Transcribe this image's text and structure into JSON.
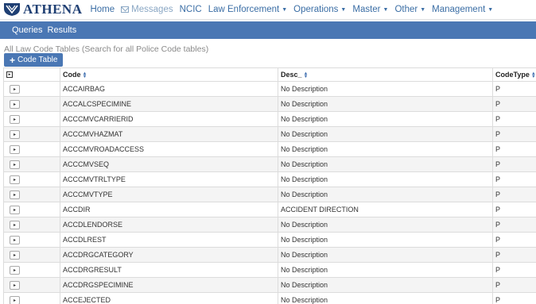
{
  "brand": {
    "name": "ATHENA",
    "color": "#1f3f73"
  },
  "topnav": {
    "home": "Home",
    "messages": "Messages",
    "ncic": "NCIC",
    "law_enforcement": "Law Enforcement",
    "operations": "Operations",
    "master": "Master",
    "other": "Other",
    "management": "Management"
  },
  "subnav": {
    "queries": "Queries",
    "results": "Results",
    "bg_color": "#4a77b4"
  },
  "page": {
    "caption": "All Law Code Tables (Search for all Police Code tables)",
    "add_button": "Code Table"
  },
  "table": {
    "headers": {
      "code": "Code",
      "desc": "Desc_",
      "codetype": "CodeType"
    },
    "rows": [
      {
        "code": "ACCAIRBAG",
        "desc": "No Description",
        "type": "P"
      },
      {
        "code": "ACCALCSPECIMINE",
        "desc": "No Description",
        "type": "P"
      },
      {
        "code": "ACCCMVCARRIERID",
        "desc": "No Description",
        "type": "P"
      },
      {
        "code": "ACCCMVHAZMAT",
        "desc": "No Description",
        "type": "P"
      },
      {
        "code": "ACCCMVROADACCESS",
        "desc": "No Description",
        "type": "P"
      },
      {
        "code": "ACCCMVSEQ",
        "desc": "No Description",
        "type": "P"
      },
      {
        "code": "ACCCMVTRLTYPE",
        "desc": "No Description",
        "type": "P"
      },
      {
        "code": "ACCCMVTYPE",
        "desc": "No Description",
        "type": "P"
      },
      {
        "code": "ACCDIR",
        "desc": "ACCIDENT DIRECTION",
        "type": "P"
      },
      {
        "code": "ACCDLENDORSE",
        "desc": "No Description",
        "type": "P"
      },
      {
        "code": "ACCDLREST",
        "desc": "No Description",
        "type": "P"
      },
      {
        "code": "ACCDRGCATEGORY",
        "desc": "No Description",
        "type": "P"
      },
      {
        "code": "ACCDRGRESULT",
        "desc": "No Description",
        "type": "P"
      },
      {
        "code": "ACCDRGSPECIMINE",
        "desc": "No Description",
        "type": "P"
      },
      {
        "code": "ACCEJECTED",
        "desc": "No Description",
        "type": "P"
      }
    ]
  }
}
